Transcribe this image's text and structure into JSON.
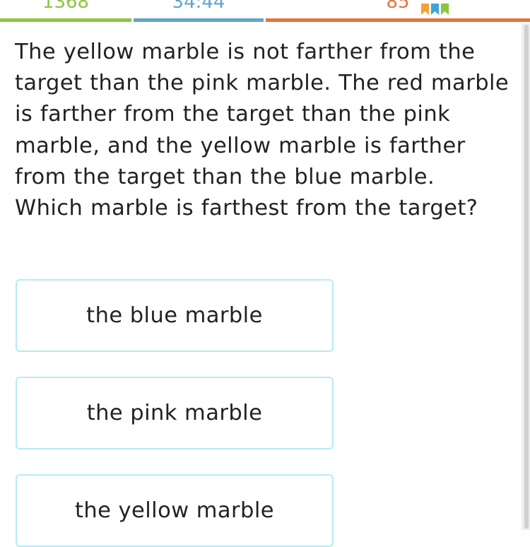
{
  "stats": {
    "answered": {
      "value": "1368",
      "color": "#8cc63e"
    },
    "time": {
      "value": "34:44",
      "color": "#5fa6c9"
    },
    "score": {
      "value": "85",
      "color": "#e2743f",
      "ribbon_colors": [
        "#f4a23a",
        "#3ba5d8",
        "#8cc63e"
      ]
    }
  },
  "question": "The yellow marble is not farther from the target than the pink marble. The red marble is farther from the target than the pink marble, and the yellow marble is farther from the target than the blue marble. Which marble is farthest from the target?",
  "options": [
    {
      "label": "the blue marble"
    },
    {
      "label": "the pink marble"
    },
    {
      "label": "the yellow marble"
    }
  ],
  "colors": {
    "option_border": "#b6ebf6",
    "text": "#222222"
  }
}
